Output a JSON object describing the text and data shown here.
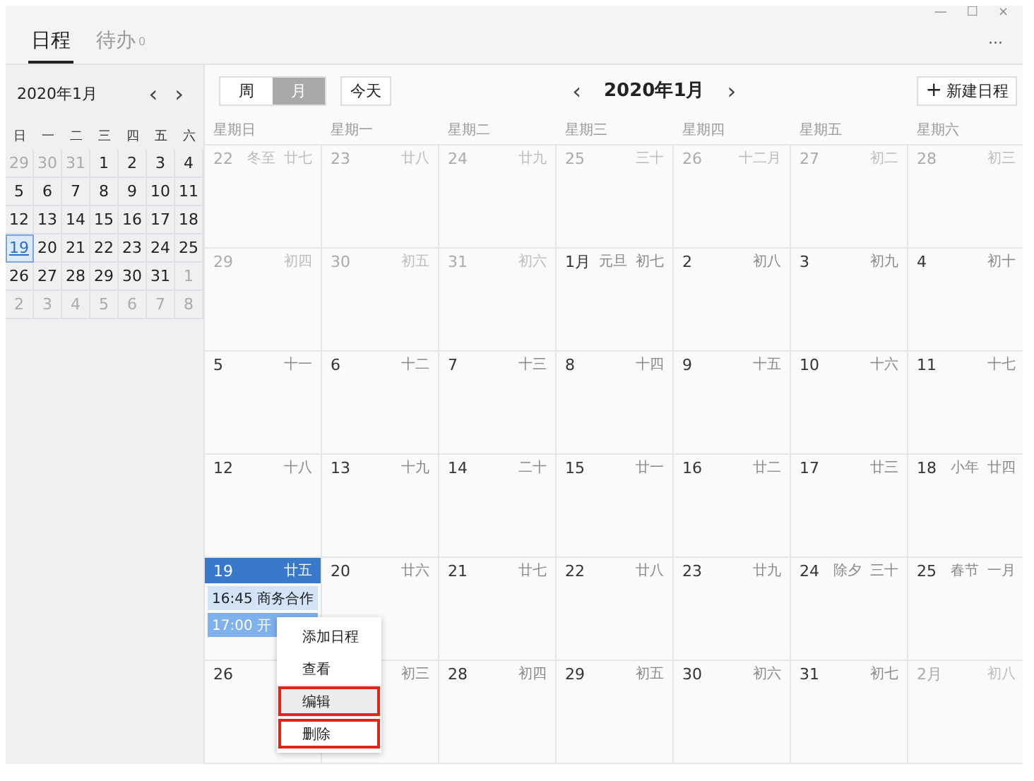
{
  "window_controls": [
    "—",
    "☐",
    "×"
  ],
  "tabs": [
    {
      "label": "日程",
      "selected": true
    },
    {
      "label": "待办",
      "count": "0",
      "selected": false
    }
  ],
  "more_menu": "···",
  "mini_calendar": {
    "title": "2020年1月",
    "prev": "‹",
    "next": "›",
    "weekdays": [
      "日",
      "一",
      "二",
      "三",
      "四",
      "五",
      "六"
    ],
    "weeks": [
      [
        {
          "day": "29",
          "in_month": false,
          "selected": false
        },
        {
          "day": "30",
          "in_month": false,
          "selected": false
        },
        {
          "day": "31",
          "in_month": false,
          "selected": false
        },
        {
          "day": "1",
          "in_month": true,
          "selected": false
        },
        {
          "day": "2",
          "in_month": true,
          "selected": false
        },
        {
          "day": "3",
          "in_month": true,
          "selected": false
        },
        {
          "day": "4",
          "in_month": true,
          "selected": false
        }
      ],
      [
        {
          "day": "5",
          "in_month": true,
          "selected": false
        },
        {
          "day": "6",
          "in_month": true,
          "selected": false
        },
        {
          "day": "7",
          "in_month": true,
          "selected": false
        },
        {
          "day": "8",
          "in_month": true,
          "selected": false
        },
        {
          "day": "9",
          "in_month": true,
          "selected": false
        },
        {
          "day": "10",
          "in_month": true,
          "selected": false
        },
        {
          "day": "11",
          "in_month": true,
          "selected": false
        }
      ],
      [
        {
          "day": "12",
          "in_month": true,
          "selected": false
        },
        {
          "day": "13",
          "in_month": true,
          "selected": false
        },
        {
          "day": "14",
          "in_month": true,
          "selected": false
        },
        {
          "day": "15",
          "in_month": true,
          "selected": false
        },
        {
          "day": "16",
          "in_month": true,
          "selected": false
        },
        {
          "day": "17",
          "in_month": true,
          "selected": false
        },
        {
          "day": "18",
          "in_month": true,
          "selected": false
        }
      ],
      [
        {
          "day": "19",
          "in_month": true,
          "selected": true
        },
        {
          "day": "20",
          "in_month": true,
          "selected": false
        },
        {
          "day": "21",
          "in_month": true,
          "selected": false
        },
        {
          "day": "22",
          "in_month": true,
          "selected": false
        },
        {
          "day": "23",
          "in_month": true,
          "selected": false
        },
        {
          "day": "24",
          "in_month": true,
          "selected": false
        },
        {
          "day": "25",
          "in_month": true,
          "selected": false
        }
      ],
      [
        {
          "day": "26",
          "in_month": true,
          "selected": false
        },
        {
          "day": "27",
          "in_month": true,
          "selected": false
        },
        {
          "day": "28",
          "in_month": true,
          "selected": false
        },
        {
          "day": "29",
          "in_month": true,
          "selected": false
        },
        {
          "day": "30",
          "in_month": true,
          "selected": false
        },
        {
          "day": "31",
          "in_month": true,
          "selected": false
        },
        {
          "day": "1",
          "in_month": false,
          "selected": false
        }
      ],
      [
        {
          "day": "2",
          "in_month": false,
          "selected": false
        },
        {
          "day": "3",
          "in_month": false,
          "selected": false
        },
        {
          "day": "4",
          "in_month": false,
          "selected": false
        },
        {
          "day": "5",
          "in_month": false,
          "selected": false
        },
        {
          "day": "6",
          "in_month": false,
          "selected": false
        },
        {
          "day": "7",
          "in_month": false,
          "selected": false
        },
        {
          "day": "8",
          "in_month": false,
          "selected": false
        }
      ]
    ]
  },
  "view_switch": [
    {
      "label": "周",
      "selected": false
    },
    {
      "label": "月",
      "selected": true
    }
  ],
  "today_button": "今天",
  "nav": {
    "prev": "‹",
    "title": "2020年1月",
    "next": "›"
  },
  "new_button": {
    "icon": "+",
    "label": "新建日程"
  },
  "weekdays": [
    "星期日",
    "星期一",
    "星期二",
    "星期三",
    "星期四",
    "星期五",
    "星期六"
  ],
  "weeks": [
    [
      {
        "day": "22",
        "festival": "冬至",
        "lunar": "廿七",
        "in_month": false,
        "selected": false
      },
      {
        "day": "23",
        "lunar": "廿八",
        "in_month": false,
        "selected": false
      },
      {
        "day": "24",
        "lunar": "廿九",
        "in_month": false,
        "selected": false
      },
      {
        "day": "25",
        "lunar": "三十",
        "in_month": false,
        "selected": false
      },
      {
        "day": "26",
        "lunar": "十二月",
        "in_month": false,
        "selected": false
      },
      {
        "day": "27",
        "lunar": "初二",
        "in_month": false,
        "selected": false
      },
      {
        "day": "28",
        "lunar": "初三",
        "in_month": false,
        "selected": false
      }
    ],
    [
      {
        "day": "29",
        "lunar": "初四",
        "in_month": false,
        "selected": false
      },
      {
        "day": "30",
        "lunar": "初五",
        "in_month": false,
        "selected": false
      },
      {
        "day": "31",
        "lunar": "初六",
        "in_month": false,
        "selected": false
      },
      {
        "day": "1月",
        "festival": "元旦",
        "lunar": "初七",
        "in_month": true,
        "selected": false
      },
      {
        "day": "2",
        "lunar": "初八",
        "in_month": true,
        "selected": false
      },
      {
        "day": "3",
        "lunar": "初九",
        "in_month": true,
        "selected": false
      },
      {
        "day": "4",
        "lunar": "初十",
        "in_month": true,
        "selected": false
      }
    ],
    [
      {
        "day": "5",
        "lunar": "十一",
        "in_month": true,
        "selected": false
      },
      {
        "day": "6",
        "lunar": "十二",
        "in_month": true,
        "selected": false
      },
      {
        "day": "7",
        "lunar": "十三",
        "in_month": true,
        "selected": false
      },
      {
        "day": "8",
        "lunar": "十四",
        "in_month": true,
        "selected": false
      },
      {
        "day": "9",
        "lunar": "十五",
        "in_month": true,
        "selected": false
      },
      {
        "day": "10",
        "lunar": "十六",
        "in_month": true,
        "selected": false
      },
      {
        "day": "11",
        "lunar": "十七",
        "in_month": true,
        "selected": false
      }
    ],
    [
      {
        "day": "12",
        "lunar": "十八",
        "in_month": true,
        "selected": false
      },
      {
        "day": "13",
        "lunar": "十九",
        "in_month": true,
        "selected": false
      },
      {
        "day": "14",
        "lunar": "二十",
        "in_month": true,
        "selected": false
      },
      {
        "day": "15",
        "lunar": "廿一",
        "in_month": true,
        "selected": false
      },
      {
        "day": "16",
        "lunar": "廿二",
        "in_month": true,
        "selected": false
      },
      {
        "day": "17",
        "lunar": "廿三",
        "in_month": true,
        "selected": false
      },
      {
        "day": "18",
        "festival": "小年",
        "lunar": "廿四",
        "in_month": true,
        "selected": false
      }
    ],
    [
      {
        "day": "19",
        "lunar": "廿五",
        "in_month": true,
        "selected": true,
        "events": [
          {
            "text": "16:45 商务合作",
            "selected": false
          },
          {
            "text": "17:00 开",
            "selected": true
          }
        ]
      },
      {
        "day": "20",
        "lunar": "廿六",
        "in_month": true,
        "selected": false
      },
      {
        "day": "21",
        "lunar": "廿七",
        "in_month": true,
        "selected": false
      },
      {
        "day": "22",
        "lunar": "廿八",
        "in_month": true,
        "selected": false
      },
      {
        "day": "23",
        "lunar": "廿九",
        "in_month": true,
        "selected": false
      },
      {
        "day": "24",
        "festival": "除夕",
        "lunar": "三十",
        "in_month": true,
        "selected": false
      },
      {
        "day": "25",
        "festival": "春节",
        "lunar": "一月",
        "in_month": true,
        "selected": false
      }
    ],
    [
      {
        "day": "26",
        "in_month": true,
        "selected": false
      },
      {
        "lunar": "初三",
        "in_month": true,
        "selected": false
      },
      {
        "day": "28",
        "lunar": "初四",
        "in_month": true,
        "selected": false
      },
      {
        "day": "29",
        "lunar": "初五",
        "in_month": true,
        "selected": false
      },
      {
        "day": "30",
        "lunar": "初六",
        "in_month": true,
        "selected": false
      },
      {
        "day": "31",
        "lunar": "初七",
        "in_month": true,
        "selected": false
      },
      {
        "day": "2月",
        "lunar": "初八",
        "in_month": false,
        "selected": false
      }
    ]
  ],
  "context_menu": [
    {
      "label": "添加日程",
      "selected": false,
      "outlined": false
    },
    {
      "label": "查看",
      "selected": false,
      "outlined": false
    },
    {
      "label": "编辑",
      "selected": true,
      "outlined": true
    },
    {
      "label": "删除",
      "selected": false,
      "outlined": true
    }
  ]
}
